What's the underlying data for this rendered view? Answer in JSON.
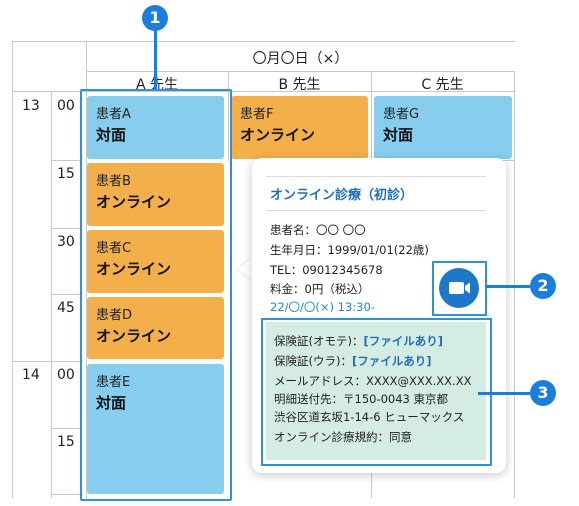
{
  "header": {
    "date": "〇月〇日（×）"
  },
  "doctors": [
    "A 先生",
    "B 先生",
    "C 先生"
  ],
  "times": {
    "h13": "13",
    "h14": "14",
    "m00a": "00",
    "m15a": "15",
    "m30": "30",
    "m45": "45",
    "m00b": "00",
    "m15b": "15"
  },
  "appointments": [
    {
      "patient": "患者A",
      "type": "対面"
    },
    {
      "patient": "患者F",
      "type": "オンライン"
    },
    {
      "patient": "患者G",
      "type": "対面"
    },
    {
      "patient": "患者B",
      "type": "オンライン"
    },
    {
      "patient": "患者C",
      "type": "オンライン"
    },
    {
      "patient": "患者D",
      "type": "オンライン"
    },
    {
      "patient": "患者E",
      "type": "対面"
    }
  ],
  "popup": {
    "title": "オンライン診療（初診）",
    "name": "患者名：〇〇 〇〇",
    "dob": "生年月日：1999/01/01(22歳)",
    "tel": "TEL：09012345678",
    "fee": "料金：0円（税込）",
    "datetime": "22/〇/〇(×) 13:30-",
    "insurance_front_label": "保険証(オモテ)：",
    "insurance_front_value": "[ファイルあり]",
    "insurance_back_label": "保険証(ウラ)：",
    "insurance_back_value": "[ファイルあり]",
    "email": "メールアドレス：XXXX@XXX.XX.XX",
    "address1": "明細送付先：〒150-0043 東京都",
    "address2": "渋谷区道玄坂1-14-6 ヒューマックス",
    "terms": "オンライン診療規約：同意"
  },
  "callouts": [
    "1",
    "2",
    "3"
  ],
  "colors": {
    "in_person": "#87cdee",
    "online": "#f3b04a",
    "callout": "#1a7fdc",
    "accent_text": "#1e6fb8",
    "info_panel": "#d4ece2"
  },
  "icons": {
    "video": "video-camera-icon"
  }
}
